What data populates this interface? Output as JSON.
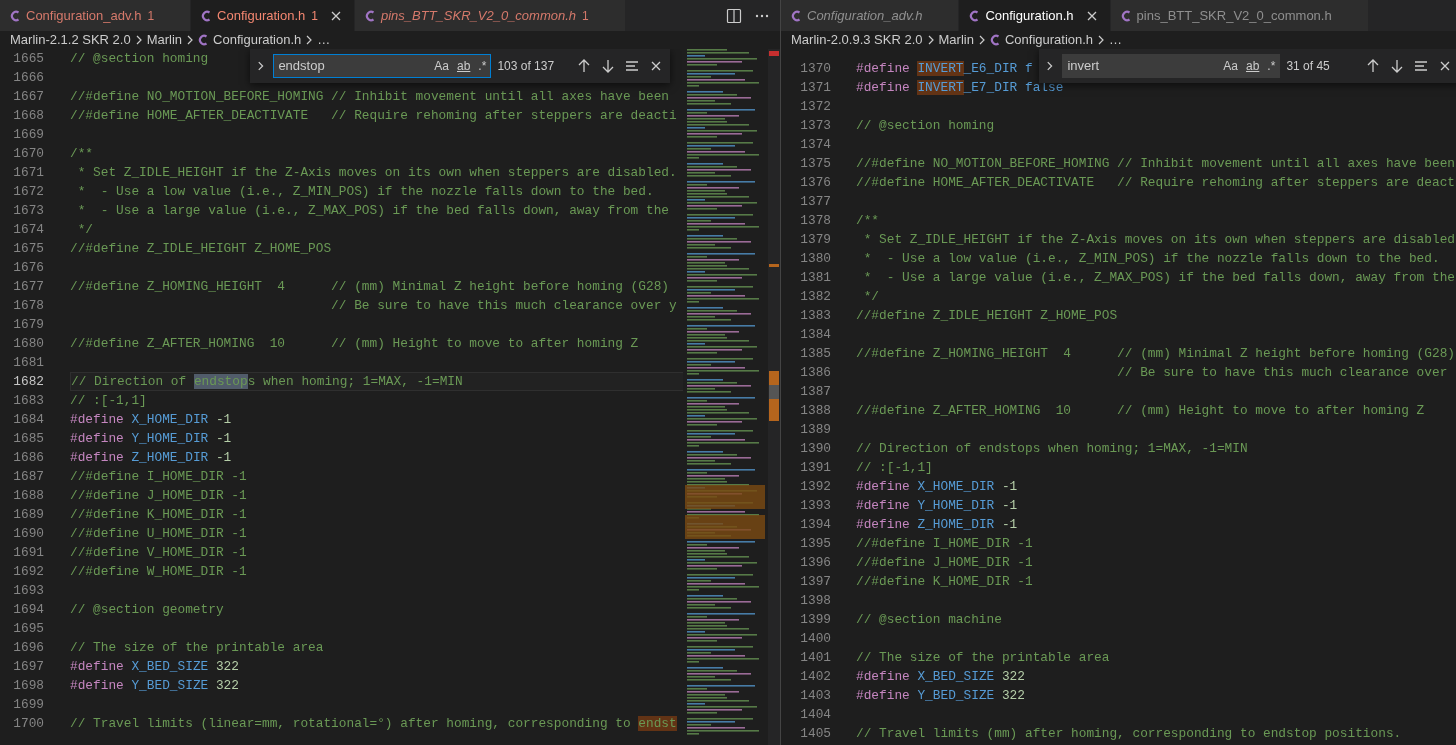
{
  "panes": [
    {
      "tabs": [
        {
          "label": "Configuration_adv.h",
          "badge": "1",
          "selected": false,
          "preview": false,
          "error": true
        },
        {
          "label": "Configuration.h",
          "badge": "1",
          "selected": true,
          "preview": false,
          "error": true
        },
        {
          "label": "pins_BTT_SKR_V2_0_common.h",
          "badge": "1",
          "selected": false,
          "preview": true,
          "error": true
        }
      ],
      "editor_actions": true,
      "breadcrumb": {
        "items": [
          {
            "label": "Marlin-2.1.2 SKR 2.0",
            "file": false
          },
          {
            "label": "Marlin",
            "file": false
          },
          {
            "label": "Configuration.h",
            "file": true
          }
        ],
        "more": "…"
      },
      "find": {
        "query": "endstop",
        "focused": true,
        "options": [
          {
            "label": "Aa",
            "selected": false
          },
          {
            "label": "ab",
            "selected": false
          },
          {
            "label": ".*",
            "selected": false
          }
        ],
        "result": "103 of 137"
      },
      "minimap": true,
      "lines": [
        {
          "number": "1665",
          "tokens": [
            {
              "kind": "comment",
              "text": "// @section homing"
            }
          ]
        },
        {
          "number": "1666"
        },
        {
          "number": "1667",
          "tokens": [
            {
              "kind": "comment",
              "text": "//#define NO_MOTION_BEFORE_HOMING // Inhibit movement until all axes have been"
            }
          ]
        },
        {
          "number": "1668",
          "tokens": [
            {
              "kind": "comment",
              "text": "//#define HOME_AFTER_DEACTIVATE   // Require rehoming after steppers are deacti"
            }
          ]
        },
        {
          "number": "1669"
        },
        {
          "number": "1670",
          "tokens": [
            {
              "kind": "comment",
              "text": "/**"
            }
          ]
        },
        {
          "number": "1671",
          "tokens": [
            {
              "kind": "comment",
              "text": " * Set Z_IDLE_HEIGHT if the Z-Axis moves on its own when steppers are disabled."
            }
          ]
        },
        {
          "number": "1672",
          "tokens": [
            {
              "kind": "comment",
              "text": " *  - Use a low value (i.e., Z_MIN_POS) if the nozzle falls down to the bed."
            }
          ]
        },
        {
          "number": "1673",
          "tokens": [
            {
              "kind": "comment",
              "text": " *  - Use a large value (i.e., Z_MAX_POS) if the bed falls down, away from the"
            }
          ]
        },
        {
          "number": "1674",
          "tokens": [
            {
              "kind": "comment",
              "text": " */"
            }
          ]
        },
        {
          "number": "1675",
          "tokens": [
            {
              "kind": "comment",
              "text": "//#define Z_IDLE_HEIGHT Z_HOME_POS"
            }
          ]
        },
        {
          "number": "1676"
        },
        {
          "number": "1677",
          "tokens": [
            {
              "kind": "comment",
              "text": "//#define Z_HOMING_HEIGHT  4      // (mm) Minimal Z height before homing (G28)"
            }
          ]
        },
        {
          "number": "1678",
          "tokens": [
            {
              "kind": "comment",
              "text": "                                  // Be sure to have this much clearance over y"
            }
          ]
        },
        {
          "number": "1679"
        },
        {
          "number": "1680",
          "tokens": [
            {
              "kind": "comment",
              "text": "//#define Z_AFTER_HOMING  10      // (mm) Height to move to after homing Z"
            }
          ]
        },
        {
          "number": "1681"
        },
        {
          "number": "1682",
          "current": true,
          "tokens": [
            {
              "kind": "comment",
              "text": "// Direction of "
            },
            {
              "kind": "comment",
              "text": "endstop",
              "match": true,
              "active": true
            },
            {
              "kind": "comment",
              "text": "s when homing; 1=MAX, -1=MIN"
            }
          ]
        },
        {
          "number": "1683",
          "tokens": [
            {
              "kind": "comment",
              "text": "// :[-1,1]"
            }
          ]
        },
        {
          "number": "1684",
          "tokens": [
            {
              "kind": "directive",
              "text": "#define"
            },
            {
              "kind": "macro",
              "text": " X_HOME_DIR"
            },
            {
              "kind": "number",
              "text": " -1"
            }
          ]
        },
        {
          "number": "1685",
          "tokens": [
            {
              "kind": "directive",
              "text": "#define"
            },
            {
              "kind": "macro",
              "text": " Y_HOME_DIR"
            },
            {
              "kind": "number",
              "text": " -1"
            }
          ]
        },
        {
          "number": "1686",
          "tokens": [
            {
              "kind": "directive",
              "text": "#define"
            },
            {
              "kind": "macro",
              "text": " Z_HOME_DIR"
            },
            {
              "kind": "number",
              "text": " -1"
            }
          ]
        },
        {
          "number": "1687",
          "tokens": [
            {
              "kind": "comment",
              "text": "//#define I_HOME_DIR -1"
            }
          ]
        },
        {
          "number": "1688",
          "tokens": [
            {
              "kind": "comment",
              "text": "//#define J_HOME_DIR -1"
            }
          ]
        },
        {
          "number": "1689",
          "tokens": [
            {
              "kind": "comment",
              "text": "//#define K_HOME_DIR -1"
            }
          ]
        },
        {
          "number": "1690",
          "tokens": [
            {
              "kind": "comment",
              "text": "//#define U_HOME_DIR -1"
            }
          ]
        },
        {
          "number": "1691",
          "tokens": [
            {
              "kind": "comment",
              "text": "//#define V_HOME_DIR -1"
            }
          ]
        },
        {
          "number": "1692",
          "tokens": [
            {
              "kind": "comment",
              "text": "//#define W_HOME_DIR -1"
            }
          ]
        },
        {
          "number": "1693"
        },
        {
          "number": "1694",
          "tokens": [
            {
              "kind": "comment",
              "text": "// @section geometry"
            }
          ]
        },
        {
          "number": "1695"
        },
        {
          "number": "1696",
          "tokens": [
            {
              "kind": "comment",
              "text": "// The size of the printable area"
            }
          ]
        },
        {
          "number": "1697",
          "tokens": [
            {
              "kind": "directive",
              "text": "#define"
            },
            {
              "kind": "macro",
              "text": " X_BED_SIZE"
            },
            {
              "kind": "number",
              "text": " 322"
            }
          ]
        },
        {
          "number": "1698",
          "tokens": [
            {
              "kind": "directive",
              "text": "#define"
            },
            {
              "kind": "macro",
              "text": " Y_BED_SIZE"
            },
            {
              "kind": "number",
              "text": " 322"
            }
          ]
        },
        {
          "number": "1699"
        },
        {
          "number": "1700",
          "tokens": [
            {
              "kind": "comment",
              "text": "// Travel limits (linear=mm, rotational=°) after homing, corresponding to "
            },
            {
              "kind": "comment",
              "text": "endst",
              "match": true,
              "active": false
            }
          ]
        }
      ]
    },
    {
      "tabs": [
        {
          "label": "Configuration_adv.h",
          "selected": false,
          "preview": true,
          "error": false
        },
        {
          "label": "Configuration.h",
          "selected": true,
          "preview": false,
          "error": false
        },
        {
          "label": "pins_BTT_SKR_V2_0_common.h",
          "selected": false,
          "preview": false,
          "error": false
        }
      ],
      "editor_actions": false,
      "breadcrumb": {
        "items": [
          {
            "label": "Marlin-2.0.9.3 SKR 2.0",
            "file": false
          },
          {
            "label": "Marlin",
            "file": false
          },
          {
            "label": "Configuration.h",
            "file": true
          }
        ],
        "more": "…"
      },
      "find": {
        "query": "invert",
        "focused": false,
        "options": [
          {
            "label": "Aa",
            "selected": false
          },
          {
            "label": "ab",
            "selected": false
          },
          {
            "label": ".*",
            "selected": false
          }
        ],
        "result": "31 of 45"
      },
      "minimap": false,
      "lines": [
        {
          "number": "1370",
          "tokens": [
            {
              "kind": "directive",
              "text": "#define "
            },
            {
              "kind": "macro",
              "text": "INVERT",
              "match": true,
              "active": false
            },
            {
              "kind": "macro",
              "text": "_E6_DIR"
            },
            {
              "kind": "keyword",
              "text": " f"
            }
          ]
        },
        {
          "number": "1371",
          "tokens": [
            {
              "kind": "directive",
              "text": "#define "
            },
            {
              "kind": "macro",
              "text": "INVERT",
              "match": true,
              "active": false
            },
            {
              "kind": "macro",
              "text": "_E7_DIR"
            },
            {
              "kind": "keyword",
              "text": " false"
            }
          ]
        },
        {
          "number": "1372"
        },
        {
          "number": "1373",
          "tokens": [
            {
              "kind": "comment",
              "text": "// @section homing"
            }
          ]
        },
        {
          "number": "1374"
        },
        {
          "number": "1375",
          "tokens": [
            {
              "kind": "comment",
              "text": "//#define NO_MOTION_BEFORE_HOMING // Inhibit movement until all axes have been"
            }
          ]
        },
        {
          "number": "1376",
          "tokens": [
            {
              "kind": "comment",
              "text": "//#define HOME_AFTER_DEACTIVATE   // Require rehoming after steppers are deact"
            }
          ]
        },
        {
          "number": "1377"
        },
        {
          "number": "1378",
          "tokens": [
            {
              "kind": "comment",
              "text": "/**"
            }
          ]
        },
        {
          "number": "1379",
          "tokens": [
            {
              "kind": "comment",
              "text": " * Set Z_IDLE_HEIGHT if the Z-Axis moves on its own when steppers are disabled"
            }
          ]
        },
        {
          "number": "1380",
          "tokens": [
            {
              "kind": "comment",
              "text": " *  - Use a low value (i.e., Z_MIN_POS) if the nozzle falls down to the bed."
            }
          ]
        },
        {
          "number": "1381",
          "tokens": [
            {
              "kind": "comment",
              "text": " *  - Use a large value (i.e., Z_MAX_POS) if the bed falls down, away from the"
            }
          ]
        },
        {
          "number": "1382",
          "tokens": [
            {
              "kind": "comment",
              "text": " */"
            }
          ]
        },
        {
          "number": "1383",
          "tokens": [
            {
              "kind": "comment",
              "text": "//#define Z_IDLE_HEIGHT Z_HOME_POS"
            }
          ]
        },
        {
          "number": "1384"
        },
        {
          "number": "1385",
          "tokens": [
            {
              "kind": "comment",
              "text": "//#define Z_HOMING_HEIGHT  4      // (mm) Minimal Z height before homing (G28)"
            }
          ]
        },
        {
          "number": "1386",
          "tokens": [
            {
              "kind": "comment",
              "text": "                                  // Be sure to have this much clearance over"
            }
          ]
        },
        {
          "number": "1387"
        },
        {
          "number": "1388",
          "tokens": [
            {
              "kind": "comment",
              "text": "//#define Z_AFTER_HOMING  10      // (mm) Height to move to after homing Z"
            }
          ]
        },
        {
          "number": "1389"
        },
        {
          "number": "1390",
          "tokens": [
            {
              "kind": "comment",
              "text": "// Direction of endstops when homing; 1=MAX, -1=MIN"
            }
          ]
        },
        {
          "number": "1391",
          "tokens": [
            {
              "kind": "comment",
              "text": "// :[-1,1]"
            }
          ]
        },
        {
          "number": "1392",
          "tokens": [
            {
              "kind": "directive",
              "text": "#define"
            },
            {
              "kind": "macro",
              "text": " X_HOME_DIR"
            },
            {
              "kind": "number",
              "text": " -1"
            }
          ]
        },
        {
          "number": "1393",
          "tokens": [
            {
              "kind": "directive",
              "text": "#define"
            },
            {
              "kind": "macro",
              "text": " Y_HOME_DIR"
            },
            {
              "kind": "number",
              "text": " -1"
            }
          ]
        },
        {
          "number": "1394",
          "tokens": [
            {
              "kind": "directive",
              "text": "#define"
            },
            {
              "kind": "macro",
              "text": " Z_HOME_DIR"
            },
            {
              "kind": "number",
              "text": " -1"
            }
          ]
        },
        {
          "number": "1395",
          "tokens": [
            {
              "kind": "comment",
              "text": "//#define I_HOME_DIR -1"
            }
          ]
        },
        {
          "number": "1396",
          "tokens": [
            {
              "kind": "comment",
              "text": "//#define J_HOME_DIR -1"
            }
          ]
        },
        {
          "number": "1397",
          "tokens": [
            {
              "kind": "comment",
              "text": "//#define K_HOME_DIR -1"
            }
          ]
        },
        {
          "number": "1398"
        },
        {
          "number": "1399",
          "tokens": [
            {
              "kind": "comment",
              "text": "// @section machine"
            }
          ]
        },
        {
          "number": "1400"
        },
        {
          "number": "1401",
          "tokens": [
            {
              "kind": "comment",
              "text": "// The size of the printable area"
            }
          ]
        },
        {
          "number": "1402",
          "tokens": [
            {
              "kind": "directive",
              "text": "#define"
            },
            {
              "kind": "macro",
              "text": " X_BED_SIZE"
            },
            {
              "kind": "number",
              "text": " 322"
            }
          ]
        },
        {
          "number": "1403",
          "tokens": [
            {
              "kind": "directive",
              "text": "#define"
            },
            {
              "kind": "macro",
              "text": " Y_BED_SIZE"
            },
            {
              "kind": "number",
              "text": " 322"
            }
          ]
        },
        {
          "number": "1404"
        },
        {
          "number": "1405",
          "tokens": [
            {
              "kind": "comment",
              "text": "// Travel limits (mm) after homing, corresponding to endstop positions."
            }
          ]
        }
      ]
    }
  ]
}
